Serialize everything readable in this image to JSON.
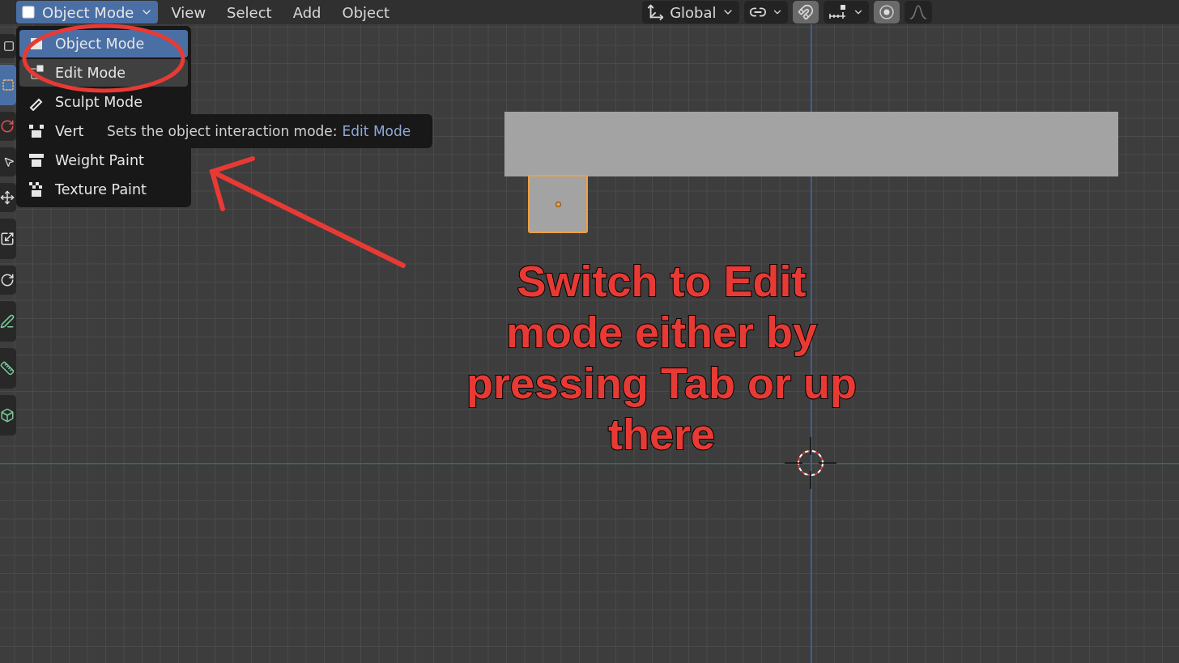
{
  "header": {
    "mode_dropdown": {
      "label": "Object Mode"
    },
    "menus": [
      "View",
      "Select",
      "Add",
      "Object"
    ],
    "transform_orientation": {
      "label": "Global"
    },
    "snap": {
      "on": true
    },
    "proportional_editing": {
      "on": true
    }
  },
  "mode_menu": {
    "items": [
      {
        "label": "Object Mode",
        "selected": true,
        "hovered": false
      },
      {
        "label": "Edit Mode",
        "selected": false,
        "hovered": true
      },
      {
        "label": "Sculpt Mode",
        "selected": false,
        "hovered": false
      },
      {
        "label": "Vert",
        "selected": false,
        "hovered": false
      },
      {
        "label": "Weight Paint",
        "selected": false,
        "hovered": false
      },
      {
        "label": "Texture Paint",
        "selected": false,
        "hovered": false
      }
    ]
  },
  "tooltip": {
    "text": "Sets the object interaction mode:",
    "value": "Edit Mode"
  },
  "annotation": {
    "lines": [
      "Switch to Edit",
      "mode either by",
      "pressing Tab or up",
      "there"
    ]
  }
}
